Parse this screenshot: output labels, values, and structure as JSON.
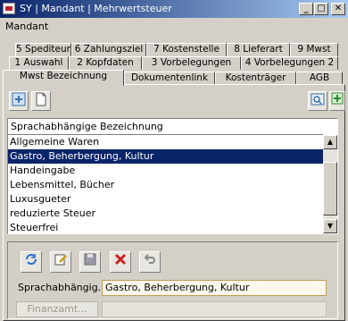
{
  "window": {
    "title": "SY | Mandant | Mehrwertsteuer",
    "buttons": [
      "_",
      "□",
      "✕"
    ]
  },
  "menu": {
    "items": [
      "Mandant"
    ]
  },
  "tabs": {
    "row1": [
      "5 Spediteur",
      "6 Zahlungsziel",
      "7 Kostenstelle",
      "8 Lieferart",
      "9 Mwst"
    ],
    "row2": [
      "1 Auswahl",
      "2 Kopfdaten",
      "3 Vorbelegungen",
      "4 Vorbelegungen 2"
    ],
    "row3": [
      "Mwst Bezeichnung",
      "Dokumentenlink",
      "Kostenträger",
      "AGB"
    ],
    "active": "Mwst Bezeichnung"
  },
  "list": {
    "header": "Sprachabhängige Bezeichnung",
    "rows": [
      "Allgemeine Waren",
      "Gastro, Beherbergung, Kultur",
      "Handeingabe",
      "Lebensmittel, Bücher",
      "Luxusgueter",
      "reduzierte Steuer",
      "Steuerfrei"
    ],
    "selected_index": 1
  },
  "form": {
    "label": "Sprachabhängig...",
    "value": "Gastro, Beherbergung, Kultur",
    "finanzamt_button": "Finanzamt...",
    "finanzamt_value": ""
  },
  "icons": {
    "top_left": [
      "grid-select-icon",
      "new-document-icon"
    ],
    "top_right": [
      "search-icon",
      "add-icon"
    ],
    "bottom": [
      "refresh-icon",
      "edit-icon",
      "save-icon",
      "delete-icon",
      "undo-icon"
    ]
  },
  "colors": {
    "selection": "#0a246a",
    "titlebar": "#0a246a",
    "input_border": "#c89a55"
  }
}
